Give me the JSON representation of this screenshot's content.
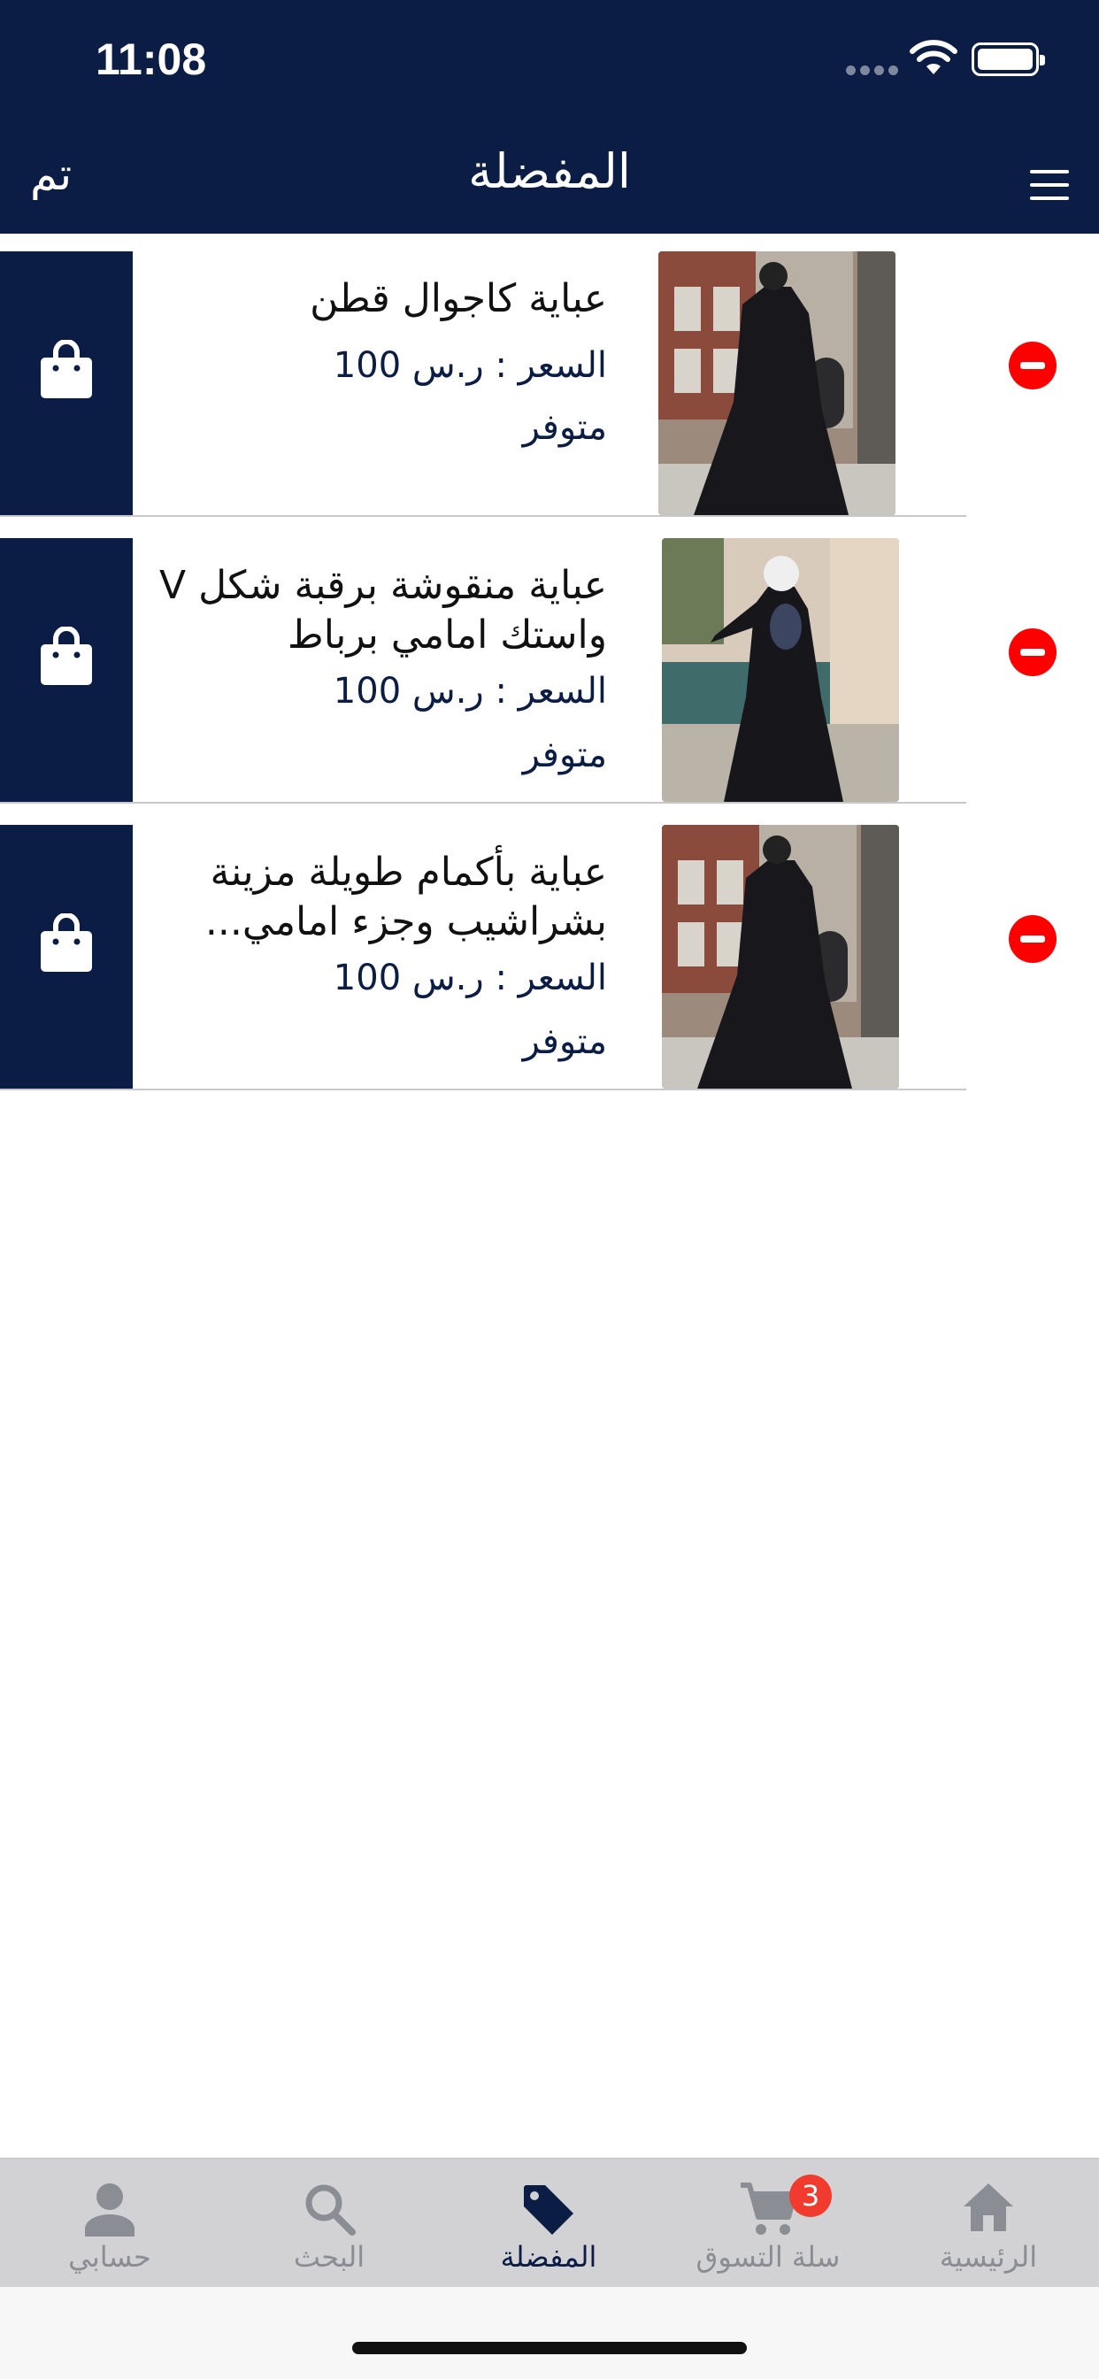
{
  "status_bar": {
    "time": "11:08"
  },
  "header": {
    "title": "المفضلة",
    "done_label": "تم"
  },
  "items": [
    {
      "title": "عباية كاجوال قطن",
      "price": "السعر : ر.س 100",
      "stock": "متوفر"
    },
    {
      "title": "عباية منقوشة برقبة شكل V واستك امامي برباط",
      "price": "السعر : ر.س 100",
      "stock": "متوفر"
    },
    {
      "title": "عباية بأكمام طويلة مزينة بشراشيب وجزء امامي...",
      "price": "السعر : ر.س 100",
      "stock": "متوفر"
    }
  ],
  "tabs": [
    {
      "label": "حسابي",
      "icon": "person-icon"
    },
    {
      "label": "البحث",
      "icon": "search-icon"
    },
    {
      "label": "المفضلة",
      "icon": "tag-icon",
      "active": true
    },
    {
      "label": "سلة التسوق",
      "icon": "cart-icon",
      "badge": "3"
    },
    {
      "label": "الرئيسية",
      "icon": "home-icon"
    }
  ],
  "colors": {
    "brand": "#0b1d45",
    "remove": "#ff0000",
    "badge": "#f23b2f"
  }
}
